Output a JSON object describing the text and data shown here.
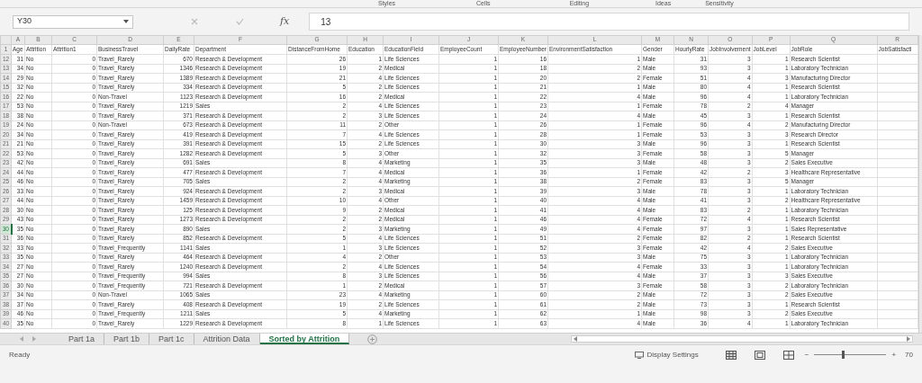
{
  "ribbon_groups": [
    "Styles",
    "Cells",
    "Editing",
    "Ideas",
    "Sensitivity"
  ],
  "name_box": "Y30",
  "formula_label": "fx",
  "formula": "13",
  "columns": [
    {
      "letter": "A",
      "header": "Age"
    },
    {
      "letter": "B",
      "header": "Attrition"
    },
    {
      "letter": "C",
      "header": "Attrition1"
    },
    {
      "letter": "D",
      "header": "BusinessTravel"
    },
    {
      "letter": "E",
      "header": "DailyRate"
    },
    {
      "letter": "F",
      "header": "Department"
    },
    {
      "letter": "G",
      "header": "DistanceFromHome"
    },
    {
      "letter": "H",
      "header": "Education"
    },
    {
      "letter": "I",
      "header": "EducationField"
    },
    {
      "letter": "J",
      "header": "EmployeeCount"
    },
    {
      "letter": "K",
      "header": "EmployeeNumber"
    },
    {
      "letter": "L",
      "header": "EnvironmentSatisfaction"
    },
    {
      "letter": "M",
      "header": "Gender"
    },
    {
      "letter": "N",
      "header": "HourlyRate"
    },
    {
      "letter": "O",
      "header": "JobInvolvement"
    },
    {
      "letter": "P",
      "header": "JobLevel"
    },
    {
      "letter": "Q",
      "header": "JobRole"
    },
    {
      "letter": "R",
      "header": "JobSatisfacti"
    }
  ],
  "header_row_number": "1",
  "rows": [
    {
      "number": "12",
      "selected": false,
      "cells": [
        "31",
        "No",
        "0",
        "Travel_Rarely",
        "670",
        "Research & Development",
        "26",
        "1",
        "Life Sciences",
        "1",
        "16",
        "1",
        "Male",
        "31",
        "3",
        "1",
        "Research Scientist"
      ]
    },
    {
      "number": "13",
      "selected": false,
      "cells": [
        "34",
        "No",
        "0",
        "Travel_Rarely",
        "1346",
        "Research & Development",
        "19",
        "2",
        "Medical",
        "1",
        "18",
        "2",
        "Male",
        "93",
        "3",
        "1",
        "Laboratory Technician"
      ]
    },
    {
      "number": "14",
      "selected": false,
      "cells": [
        "29",
        "No",
        "0",
        "Travel_Rarely",
        "1389",
        "Research & Development",
        "21",
        "4",
        "Life Sciences",
        "1",
        "20",
        "2",
        "Female",
        "51",
        "4",
        "3",
        "Manufacturing Director"
      ]
    },
    {
      "number": "15",
      "selected": false,
      "cells": [
        "32",
        "No",
        "0",
        "Travel_Rarely",
        "334",
        "Research & Development",
        "5",
        "2",
        "Life Sciences",
        "1",
        "21",
        "1",
        "Male",
        "80",
        "4",
        "1",
        "Research Scientist"
      ]
    },
    {
      "number": "16",
      "selected": false,
      "cells": [
        "22",
        "No",
        "0",
        "Non-Travel",
        "1123",
        "Research & Development",
        "16",
        "2",
        "Medical",
        "1",
        "22",
        "4",
        "Male",
        "96",
        "4",
        "1",
        "Laboratory Technician"
      ]
    },
    {
      "number": "17",
      "selected": false,
      "cells": [
        "53",
        "No",
        "0",
        "Travel_Rarely",
        "1219",
        "Sales",
        "2",
        "4",
        "Life Sciences",
        "1",
        "23",
        "1",
        "Female",
        "78",
        "2",
        "4",
        "Manager"
      ]
    },
    {
      "number": "18",
      "selected": false,
      "cells": [
        "38",
        "No",
        "0",
        "Travel_Rarely",
        "371",
        "Research & Development",
        "2",
        "3",
        "Life Sciences",
        "1",
        "24",
        "4",
        "Male",
        "45",
        "3",
        "1",
        "Research Scientist"
      ]
    },
    {
      "number": "19",
      "selected": false,
      "cells": [
        "24",
        "No",
        "0",
        "Non-Travel",
        "673",
        "Research & Development",
        "11",
        "2",
        "Other",
        "1",
        "26",
        "1",
        "Female",
        "96",
        "4",
        "2",
        "Manufacturing Director"
      ]
    },
    {
      "number": "20",
      "selected": false,
      "cells": [
        "34",
        "No",
        "0",
        "Travel_Rarely",
        "419",
        "Research & Development",
        "7",
        "4",
        "Life Sciences",
        "1",
        "28",
        "1",
        "Female",
        "53",
        "3",
        "3",
        "Research Director"
      ]
    },
    {
      "number": "21",
      "selected": false,
      "cells": [
        "21",
        "No",
        "0",
        "Travel_Rarely",
        "391",
        "Research & Development",
        "15",
        "2",
        "Life Sciences",
        "1",
        "30",
        "3",
        "Male",
        "96",
        "3",
        "1",
        "Research Scientist"
      ]
    },
    {
      "number": "22",
      "selected": false,
      "cells": [
        "53",
        "No",
        "0",
        "Travel_Rarely",
        "1282",
        "Research & Development",
        "5",
        "3",
        "Other",
        "1",
        "32",
        "3",
        "Female",
        "58",
        "3",
        "5",
        "Manager"
      ]
    },
    {
      "number": "23",
      "selected": false,
      "cells": [
        "42",
        "No",
        "0",
        "Travel_Rarely",
        "691",
        "Sales",
        "8",
        "4",
        "Marketing",
        "1",
        "35",
        "3",
        "Male",
        "48",
        "3",
        "2",
        "Sales Executive"
      ]
    },
    {
      "number": "24",
      "selected": false,
      "cells": [
        "44",
        "No",
        "0",
        "Travel_Rarely",
        "477",
        "Research & Development",
        "7",
        "4",
        "Medical",
        "1",
        "36",
        "1",
        "Female",
        "42",
        "2",
        "3",
        "Healthcare Representative"
      ]
    },
    {
      "number": "25",
      "selected": false,
      "cells": [
        "46",
        "No",
        "0",
        "Travel_Rarely",
        "705",
        "Sales",
        "2",
        "4",
        "Marketing",
        "1",
        "38",
        "2",
        "Female",
        "83",
        "3",
        "5",
        "Manager"
      ]
    },
    {
      "number": "26",
      "selected": false,
      "cells": [
        "33",
        "No",
        "0",
        "Travel_Rarely",
        "924",
        "Research & Development",
        "2",
        "3",
        "Medical",
        "1",
        "39",
        "3",
        "Male",
        "78",
        "3",
        "1",
        "Laboratory Technician"
      ]
    },
    {
      "number": "27",
      "selected": false,
      "cells": [
        "44",
        "No",
        "0",
        "Travel_Rarely",
        "1459",
        "Research & Development",
        "10",
        "4",
        "Other",
        "1",
        "40",
        "4",
        "Male",
        "41",
        "3",
        "2",
        "Healthcare Representative"
      ]
    },
    {
      "number": "28",
      "selected": false,
      "cells": [
        "30",
        "No",
        "0",
        "Travel_Rarely",
        "125",
        "Research & Development",
        "9",
        "2",
        "Medical",
        "1",
        "41",
        "4",
        "Male",
        "83",
        "2",
        "1",
        "Laboratory Technician"
      ]
    },
    {
      "number": "29",
      "selected": false,
      "cells": [
        "43",
        "No",
        "0",
        "Travel_Rarely",
        "1273",
        "Research & Development",
        "2",
        "2",
        "Medical",
        "1",
        "46",
        "4",
        "Female",
        "72",
        "4",
        "1",
        "Research Scientist"
      ]
    },
    {
      "number": "30",
      "selected": true,
      "cells": [
        "35",
        "No",
        "0",
        "Travel_Rarely",
        "890",
        "Sales",
        "2",
        "3",
        "Marketing",
        "1",
        "49",
        "4",
        "Female",
        "97",
        "3",
        "1",
        "Sales Representative"
      ]
    },
    {
      "number": "31",
      "selected": false,
      "cells": [
        "36",
        "No",
        "0",
        "Travel_Rarely",
        "852",
        "Research & Development",
        "5",
        "4",
        "Life Sciences",
        "1",
        "51",
        "2",
        "Female",
        "82",
        "2",
        "1",
        "Research Scientist"
      ]
    },
    {
      "number": "32",
      "selected": false,
      "cells": [
        "33",
        "No",
        "0",
        "Travel_Frequently",
        "1141",
        "Sales",
        "1",
        "3",
        "Life Sciences",
        "1",
        "52",
        "3",
        "Female",
        "42",
        "4",
        "2",
        "Sales Executive"
      ]
    },
    {
      "number": "33",
      "selected": false,
      "cells": [
        "35",
        "No",
        "0",
        "Travel_Rarely",
        "464",
        "Research & Development",
        "4",
        "2",
        "Other",
        "1",
        "53",
        "3",
        "Male",
        "75",
        "3",
        "1",
        "Laboratory Technician"
      ]
    },
    {
      "number": "34",
      "selected": false,
      "cells": [
        "27",
        "No",
        "0",
        "Travel_Rarely",
        "1240",
        "Research & Development",
        "2",
        "4",
        "Life Sciences",
        "1",
        "54",
        "4",
        "Female",
        "33",
        "3",
        "1",
        "Laboratory Technician"
      ]
    },
    {
      "number": "35",
      "selected": false,
      "cells": [
        "27",
        "No",
        "0",
        "Travel_Frequently",
        "994",
        "Sales",
        "8",
        "3",
        "Life Sciences",
        "1",
        "56",
        "4",
        "Male",
        "37",
        "3",
        "3",
        "Sales Executive"
      ]
    },
    {
      "number": "36",
      "selected": false,
      "cells": [
        "30",
        "No",
        "0",
        "Travel_Frequently",
        "721",
        "Research & Development",
        "1",
        "2",
        "Medical",
        "1",
        "57",
        "3",
        "Female",
        "58",
        "3",
        "2",
        "Laboratory Technician"
      ]
    },
    {
      "number": "37",
      "selected": false,
      "cells": [
        "34",
        "No",
        "0",
        "Non-Travel",
        "1065",
        "Sales",
        "23",
        "4",
        "Marketing",
        "1",
        "60",
        "2",
        "Male",
        "72",
        "3",
        "2",
        "Sales Executive"
      ]
    },
    {
      "number": "38",
      "selected": false,
      "cells": [
        "37",
        "No",
        "0",
        "Travel_Rarely",
        "408",
        "Research & Development",
        "19",
        "2",
        "Life Sciences",
        "1",
        "61",
        "2",
        "Male",
        "73",
        "3",
        "1",
        "Research Scientist"
      ]
    },
    {
      "number": "39",
      "selected": false,
      "cells": [
        "46",
        "No",
        "0",
        "Travel_Frequently",
        "1211",
        "Sales",
        "5",
        "4",
        "Marketing",
        "1",
        "62",
        "1",
        "Male",
        "98",
        "3",
        "2",
        "Sales Executive"
      ]
    },
    {
      "number": "40",
      "selected": false,
      "cells": [
        "35",
        "No",
        "0",
        "Travel_Rarely",
        "1229",
        "Research & Development",
        "8",
        "1",
        "Life Sciences",
        "1",
        "63",
        "4",
        "Male",
        "36",
        "4",
        "1",
        "Laboratory Technician"
      ]
    }
  ],
  "sheet_tabs": [
    {
      "label": "Part 1a",
      "selected": false
    },
    {
      "label": "Part 1b",
      "selected": false
    },
    {
      "label": "Part 1c",
      "selected": false
    },
    {
      "label": "Attrition Data",
      "selected": false
    },
    {
      "label": "Sorted by Attrition",
      "selected": true
    }
  ],
  "status": "Ready",
  "display_settings": "Display Settings",
  "zoom_out": "−",
  "zoom_slider": {
    "level": 0.4
  },
  "zoom_in": "+",
  "zoom": "70"
}
